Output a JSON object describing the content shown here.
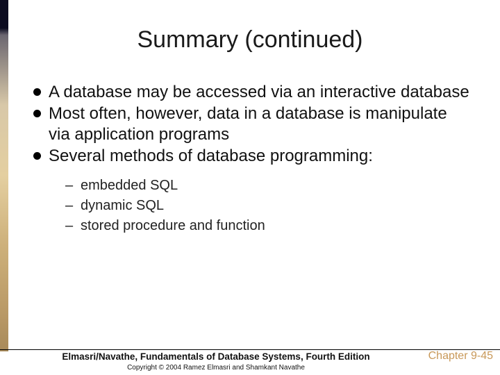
{
  "title": "Summary (continued)",
  "bullets": [
    "A database may be accessed via an interactive database",
    "Most often, however, data in a database is manipulate via application programs",
    "Several methods of database programming:"
  ],
  "sub_bullets": [
    "embedded SQL",
    "dynamic SQL",
    "stored procedure and function"
  ],
  "book_title": "Elmasri/Navathe, Fundamentals of Database Systems, Fourth Edition",
  "copyright": "Copyright © 2004 Ramez Elmasri and Shamkant Navathe",
  "chapter_label": "Chapter 9-45"
}
